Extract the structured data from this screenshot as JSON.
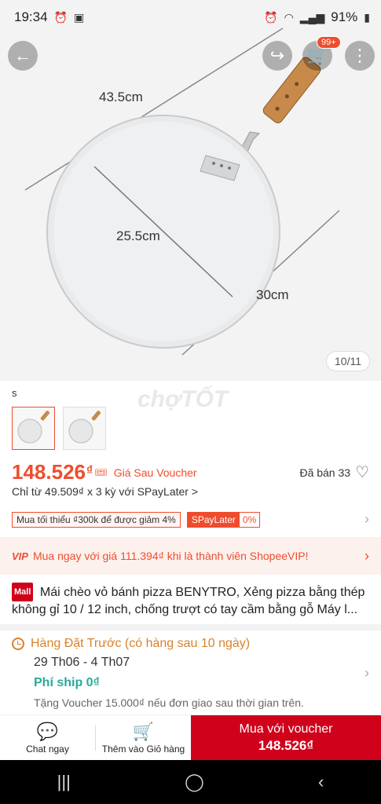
{
  "status_bar": {
    "time": "19:34",
    "battery": "91%"
  },
  "hero": {
    "dims": [
      "43.5cm",
      "25.5cm",
      "30cm"
    ],
    "counter": "10/11"
  },
  "header": {
    "cart_badge": "99+"
  },
  "variant": {
    "label": "s"
  },
  "watermark": "chợTỐT",
  "price": {
    "value": "148.526",
    "currency": "₫",
    "voucher_note": "Giá Sau Voucher",
    "sold": "Đã bán 33",
    "installment": "Chỉ từ 49.509₫ x 3 kỳ với SPayLater >"
  },
  "promo": {
    "min_order": "Mua tối thiểu ₫300k để được giảm 4%",
    "spl_label": "SPayLater",
    "spl_value": "0%"
  },
  "vip": {
    "badge": "VIP",
    "text": "Mua ngay với giá 111.394₫ khi là thành viên ShopeeVIP!"
  },
  "product": {
    "mall_badge": "Mall",
    "title": "Mái chèo vỏ bánh pizza BENYTRO, Xẻng pizza bằng thép không gỉ 10 / 12 inch, chống trượt có tay cầm bằng gỗ Máy l..."
  },
  "shipping": {
    "title": "Hàng Đặt Trước (có hàng sau 10 ngày)",
    "date": "29 Th06 - 4 Th07",
    "fee": "Phí ship 0₫",
    "note": "Tặng Voucher 15.000₫ nếu đơn giao sau thời gian trên."
  },
  "bottom": {
    "chat": "Chat ngay",
    "add_cart": "Thêm vào Giỏ hàng",
    "buy_label": "Mua với voucher",
    "buy_price": "148.526₫"
  },
  "colors": {
    "accent": "#ee4d2d",
    "mall": "#d0011b",
    "ship": "#26aa99",
    "preorder": "#d9822b"
  }
}
